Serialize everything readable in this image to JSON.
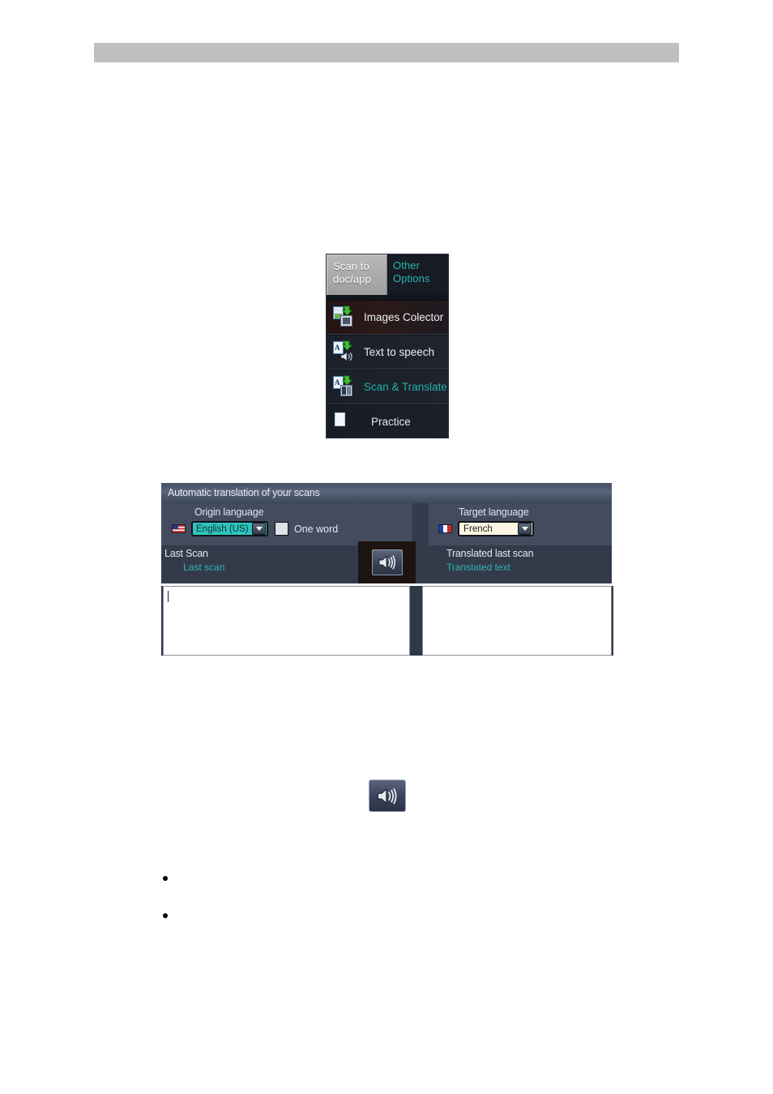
{
  "page": {
    "header_band": "",
    "background_color": "#ffffff",
    "accent_teal": "#20b2aa",
    "panel_blue": "#434c5f"
  },
  "scan_menu": {
    "tabs": [
      {
        "label": "Scan to\ndoc/app",
        "line1": "Scan to",
        "line2": "doc/app",
        "active": true
      },
      {
        "label": "Other\nOptions",
        "line1": "Other",
        "line2": "Options",
        "active": false
      }
    ],
    "items": [
      {
        "label": "Images Colector",
        "icon": "image-export-icon",
        "color": "#eceff3"
      },
      {
        "label": "Text to speech",
        "icon": "text-to-speech-icon",
        "color": "#eceff3"
      },
      {
        "label": "Scan & Translate",
        "icon": "scan-translate-icon",
        "color": "#20b2aa"
      },
      {
        "label": "Practice",
        "icon": "document-icon",
        "color": "#e7eaee"
      }
    ]
  },
  "translate_dialog": {
    "title": "Automatic translation of your scans",
    "origin": {
      "label": "Origin language",
      "flag": "us-flag-icon",
      "selected": "English (US)",
      "options": [
        "English (US)"
      ],
      "last_scan_label": "Last Scan",
      "last_scan_value": "Last scan"
    },
    "one_word": {
      "label": "One word",
      "checked": false
    },
    "target": {
      "label": "Target language",
      "flag": "fr-flag-icon",
      "selected": "French",
      "options": [
        "French"
      ],
      "translated_label": "Translated last scan",
      "translated_value": "Translated text"
    },
    "speaker_button": "speaker-icon",
    "origin_textbox_value": "",
    "target_textbox_value": ""
  },
  "standalone_speaker": {
    "icon": "speaker-icon"
  },
  "bullets": [
    {
      "text": ""
    },
    {
      "text": ""
    }
  ]
}
